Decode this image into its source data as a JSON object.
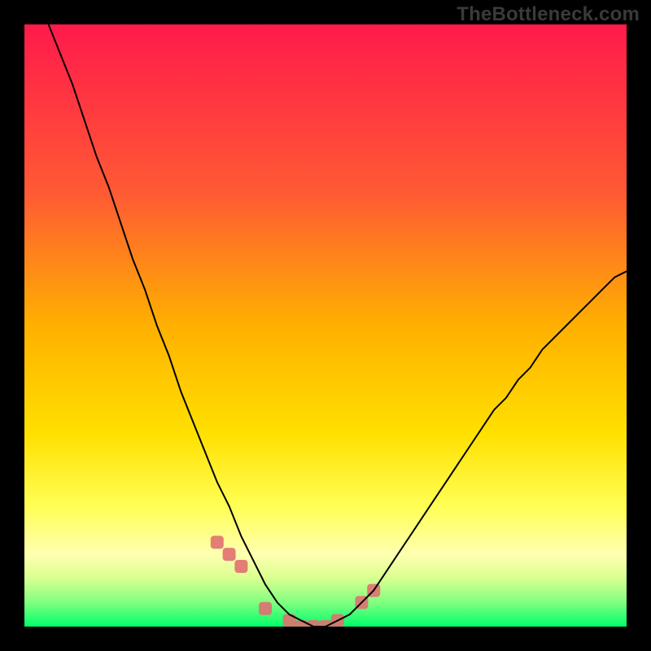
{
  "watermark": "TheBottleneck.com",
  "chart_data": {
    "type": "line",
    "title": "",
    "xlabel": "",
    "ylabel": "",
    "xlim": [
      0,
      100
    ],
    "ylim": [
      0,
      100
    ],
    "grid": false,
    "legend": false,
    "background_gradient": {
      "top": "#ff1a4b",
      "mid1": "#ff7a2f",
      "mid2": "#ffd400",
      "mid3": "#ffff66",
      "mid4": "#d6ff85",
      "bottom": "#00ff6a"
    },
    "series": [
      {
        "name": "bottleneck-curve",
        "color": "#000000",
        "x": [
          4,
          6,
          8,
          10,
          12,
          14,
          16,
          18,
          20,
          22,
          24,
          26,
          28,
          30,
          32,
          34,
          36,
          38,
          40,
          42,
          44,
          46,
          48,
          50,
          52,
          54,
          56,
          58,
          60,
          62,
          64,
          66,
          68,
          70,
          72,
          74,
          76,
          78,
          80,
          82,
          84,
          86,
          88,
          90,
          92,
          94,
          96,
          98,
          100
        ],
        "y": [
          100,
          95,
          90,
          84,
          78,
          73,
          67,
          61,
          56,
          50,
          45,
          39,
          34,
          29,
          24,
          20,
          15,
          11,
          7,
          4,
          2,
          1,
          0,
          0,
          1,
          2,
          4,
          6,
          9,
          12,
          15,
          18,
          21,
          24,
          27,
          30,
          33,
          36,
          38,
          41,
          43,
          46,
          48,
          50,
          52,
          54,
          56,
          58,
          59
        ]
      }
    ],
    "markers": {
      "name": "sample-points",
      "color": "#e07070",
      "radius": 8,
      "x": [
        32,
        34,
        36,
        40,
        44,
        46,
        48,
        50,
        52,
        56,
        58
      ],
      "y": [
        14,
        12,
        10,
        3,
        1,
        0,
        0,
        0,
        1,
        4,
        6
      ]
    },
    "minimum_x": 47
  }
}
